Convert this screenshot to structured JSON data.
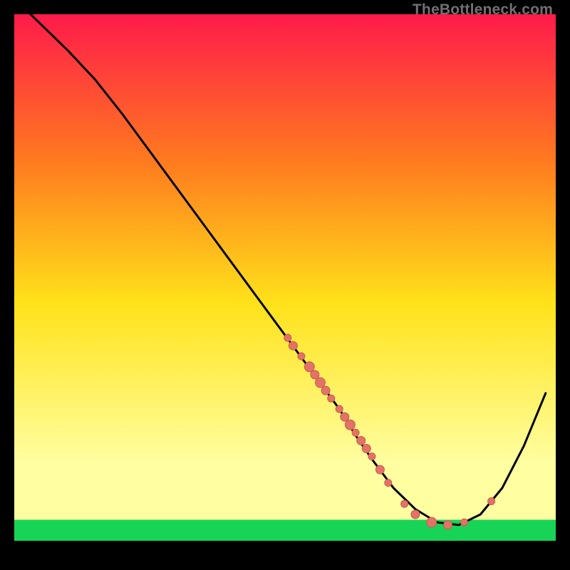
{
  "watermark": "TheBottleneck.com",
  "colors": {
    "gradient_top": "#ff1a4b",
    "gradient_mid_upper": "#ff7a1f",
    "gradient_mid": "#ffe21a",
    "gradient_lower": "#fffea0",
    "gradient_bottom_band": "#17d457",
    "curve": "#000000",
    "dot_fill": "#e27366",
    "dot_stroke": "#c85a50",
    "axis": "#000000"
  },
  "chart_data": {
    "type": "line",
    "title": "",
    "xlabel": "",
    "ylabel": "",
    "xlim": [
      0,
      100
    ],
    "ylim": [
      0,
      100
    ],
    "grid": false,
    "legend": false,
    "series": [
      {
        "name": "curve",
        "x": [
          3,
          6,
          10,
          15,
          20,
          25,
          30,
          35,
          40,
          45,
          50,
          55,
          60,
          63,
          66,
          70,
          74,
          78,
          82,
          86,
          90,
          94,
          98
        ],
        "y": [
          100,
          97,
          93,
          87.5,
          81,
          74,
          67,
          60,
          53,
          46,
          39,
          32,
          25,
          20,
          15.5,
          10,
          6,
          3.5,
          3,
          5,
          10,
          18,
          28
        ]
      }
    ],
    "scatter_overlay": {
      "name": "dots",
      "points": [
        {
          "x": 50.5,
          "y": 38.5,
          "r": 5
        },
        {
          "x": 51.5,
          "y": 37,
          "r": 6
        },
        {
          "x": 53,
          "y": 35,
          "r": 5
        },
        {
          "x": 54.5,
          "y": 33,
          "r": 7
        },
        {
          "x": 55.5,
          "y": 31.5,
          "r": 6
        },
        {
          "x": 56.5,
          "y": 30,
          "r": 7
        },
        {
          "x": 57.5,
          "y": 28.5,
          "r": 6
        },
        {
          "x": 58.5,
          "y": 27,
          "r": 5
        },
        {
          "x": 60,
          "y": 25,
          "r": 5
        },
        {
          "x": 61,
          "y": 23.5,
          "r": 6
        },
        {
          "x": 62,
          "y": 22,
          "r": 7
        },
        {
          "x": 63,
          "y": 20.5,
          "r": 5
        },
        {
          "x": 64,
          "y": 19,
          "r": 6
        },
        {
          "x": 65,
          "y": 17.5,
          "r": 6
        },
        {
          "x": 66,
          "y": 16,
          "r": 5
        },
        {
          "x": 67.5,
          "y": 13.5,
          "r": 6
        },
        {
          "x": 69,
          "y": 11,
          "r": 5
        },
        {
          "x": 72,
          "y": 7,
          "r": 5
        },
        {
          "x": 74,
          "y": 5,
          "r": 6
        },
        {
          "x": 77,
          "y": 3.5,
          "r": 7
        },
        {
          "x": 80,
          "y": 3,
          "r": 6
        },
        {
          "x": 83,
          "y": 3.5,
          "r": 5
        },
        {
          "x": 88,
          "y": 7.5,
          "r": 5
        }
      ]
    }
  }
}
